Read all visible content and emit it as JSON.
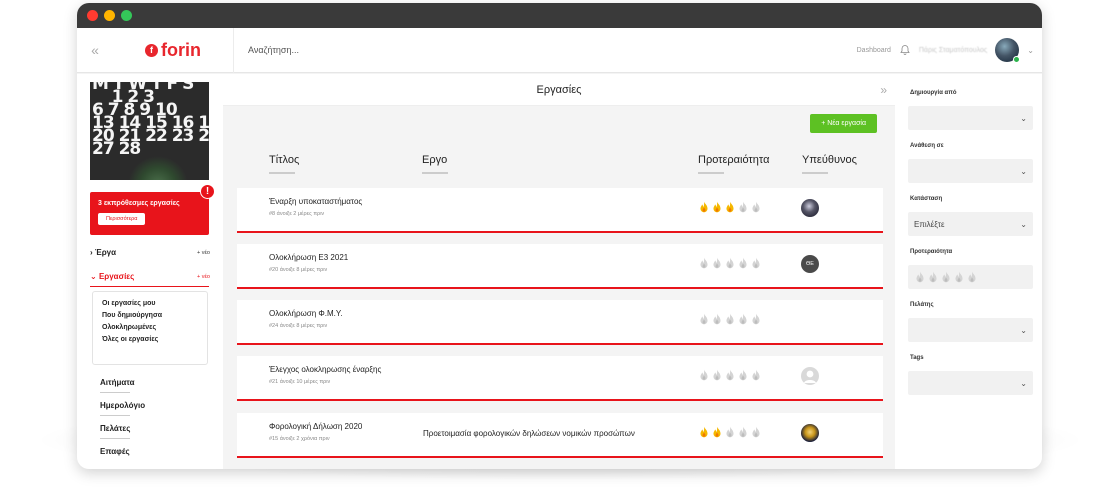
{
  "topbar": {
    "logo_text": "forin",
    "logo_mark": "f",
    "search_placeholder": "Αναζήτηση...",
    "dashboard_link": "Dashboard",
    "username": "Πάρις Σταματόπουλος"
  },
  "sidebar": {
    "calendar_rows": [
      "M T W T F S",
      "    1 2 3",
      "6 7 8 9 10",
      "13 14 15 16 17",
      "20 21 22 23 24",
      "27 28"
    ],
    "alert": {
      "text": "3 εκπρόθεσμες εργασίες",
      "button": "Περισσότερα",
      "badge": "!"
    },
    "sections": [
      {
        "label": "Έργα",
        "new": "+ νέο"
      },
      {
        "label": "Εργασίες",
        "new": "+ νέο"
      }
    ],
    "submenu": [
      "Οι εργασίες μου",
      "Που δημιούργησα",
      "Ολοκληρωμένες",
      "Όλες οι εργασίες"
    ],
    "main_nav": [
      "Αιτήματα",
      "Ημερολόγιο",
      "Πελάτες",
      "Επαφές"
    ]
  },
  "main": {
    "title": "Εργασίες",
    "new_task_button": "+ Νέα εργασία",
    "columns": [
      "Τίτλος",
      "Εργο",
      "Προτεραιότητα",
      "Υπεύθυνος"
    ],
    "tasks": [
      {
        "title": "Έναρξη υποκαταστήματος",
        "meta": "#8 άνοιξε 2 μέρες πριν",
        "project": "",
        "priority": 3,
        "assignee": "avatar-dark"
      },
      {
        "title": "Ολοκλήρωση Ε3 2021",
        "meta": "#20 άνοιξε 8 μέρες πριν",
        "project": "",
        "priority": 0,
        "assignee": "ΘΕ"
      },
      {
        "title": "Ολοκλήρωση Φ.Μ.Υ.",
        "meta": "#24 άνοιξε 8 μέρες πριν",
        "project": "",
        "priority": 0,
        "assignee": ""
      },
      {
        "title": "Έλεγχος ολοκληρωσης έναρξης",
        "meta": "#21 άνοιξε 10 μέρες πριν",
        "project": "",
        "priority": 0,
        "assignee": "avatar-blank"
      },
      {
        "title": "Φορολογική Δήλωση 2020",
        "meta": "#15 άνοιξε 2 χρόνια πριν",
        "project": "Προετοιμασία φορολογικών δηλώσεων νομικών προσώπων",
        "priority": 2,
        "assignee": "avatar-gold"
      }
    ]
  },
  "filters": {
    "created_by": "Δημιουργία από",
    "assigned_to": "Ανάθεση σε",
    "status": "Κατάσταση",
    "status_value": "Επιλέξτε",
    "priority": "Προτεραιότητα",
    "client": "Πελάτης",
    "tags": "Tags"
  },
  "colors": {
    "accent": "#e8141b",
    "green": "#5dc123",
    "flame_active": "#f5b800",
    "flame_inactive": "#d4d4d4"
  },
  "icons": [
    "collapse-left-icon",
    "bell-icon",
    "chevron-down-icon",
    "collapse-right-icon",
    "flame-icon",
    "alert-icon"
  ]
}
